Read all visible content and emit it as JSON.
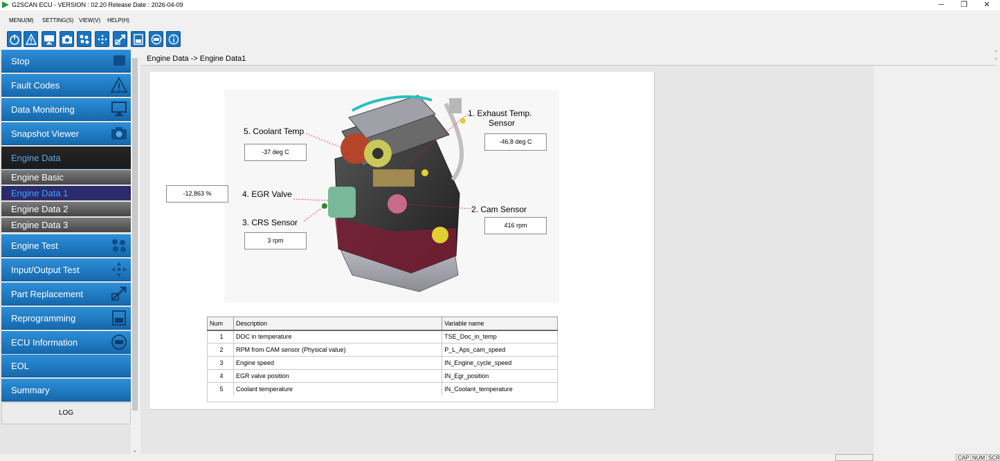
{
  "window": {
    "title": "G2SCAN ECU - VERSION : 02.20 Release Date : 2026-04-09",
    "minimize": "─",
    "restore": "❐",
    "close": "✕"
  },
  "menu": [
    "MENU(M)",
    "SETTING(S)",
    "VIEW(V)",
    "HELP(H)"
  ],
  "toolbar": {
    "icons": [
      "power-icon",
      "warning-icon",
      "monitor-icon",
      "camera-icon",
      "engine-test-icon",
      "io-arrows-icon",
      "part-replace-icon",
      "reprogram-icon",
      "ecu-icon",
      "info-icon"
    ]
  },
  "sidebar": {
    "items": [
      {
        "label": "Stop",
        "icon": "stop-icon"
      },
      {
        "label": "Fault Codes",
        "icon": "warning-icon"
      },
      {
        "label": "Data Monitoring",
        "icon": "monitor-icon"
      },
      {
        "label": "Snapshot Viewer",
        "icon": "camera-icon"
      },
      {
        "label": "Engine Data",
        "icon": ""
      },
      {
        "label": "Engine Test",
        "icon": "engine-test-icon"
      },
      {
        "label": "Input/Output Test",
        "icon": "io-arrows-icon"
      },
      {
        "label": "Part Replacement",
        "icon": "part-replace-icon"
      },
      {
        "label": "Reprogramming",
        "icon": "reprogram-icon"
      },
      {
        "label": "ECU Information",
        "icon": "ecu-icon"
      },
      {
        "label": "EOL",
        "icon": ""
      },
      {
        "label": "Summary",
        "icon": ""
      }
    ],
    "subitems": [
      "Engine Basic",
      "Engine Data 1",
      "Engine Data 2",
      "Engine Data 3"
    ],
    "log_label": "LOG"
  },
  "breadcrumb": "Engine Data -> Engine Data1",
  "sensors": {
    "exhaust": {
      "label_line1": "1. Exhaust Temp.",
      "label_line2": "Sensor",
      "value": "-46,8 deg C"
    },
    "cam": {
      "label": "2. Cam Sensor",
      "value": "416 rpm"
    },
    "crs": {
      "label": "3. CRS Sensor",
      "value": "3 rpm"
    },
    "egr": {
      "label": "4. EGR Valve",
      "value": "-12,863 %"
    },
    "coolant": {
      "label": "5. Coolant Temp",
      "value": "-37 deg C"
    }
  },
  "table": {
    "headers": [
      "Num",
      "Description",
      "Variable name"
    ],
    "rows": [
      [
        "1",
        "DOC in temperature",
        "TSE_Doc_in_temp"
      ],
      [
        "2",
        "RPM from CAM sensor (Physical value)",
        "P_L_Aps_cam_speed"
      ],
      [
        "3",
        "Engine speed",
        "IN_Engine_cycle_speed"
      ],
      [
        "4",
        "EGR valve position",
        "IN_Egr_position"
      ],
      [
        "5",
        "Coolant temperature",
        "IN_Coolant_temperature"
      ]
    ]
  },
  "statusbar": [
    "CAP",
    "NUM",
    "SCRL"
  ],
  "colors": {
    "nav_blue": "#1a74c0",
    "nav_active": "#1a1a1a",
    "sub_selected": "#2b2b6b"
  }
}
